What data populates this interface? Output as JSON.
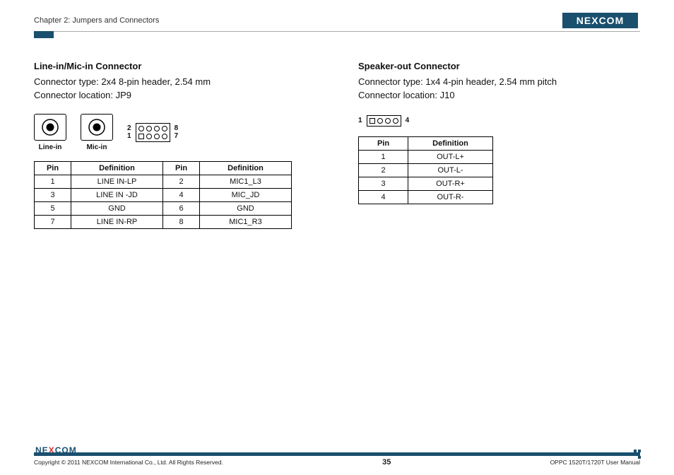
{
  "header": {
    "chapter": "Chapter 2: Jumpers and Connectors",
    "brand": "NEXCOM"
  },
  "left": {
    "title": "Line-in/Mic-in Connector",
    "type_line": "Connector type: 2x4 8-pin header, 2.54 mm",
    "loc_line": "Connector location: JP9",
    "jack1": "Line-in",
    "jack2": "Mic-in",
    "ph_tl": "2",
    "ph_bl": "1",
    "ph_tr": "8",
    "ph_br": "7",
    "cols": {
      "pin": "Pin",
      "def": "Definition"
    },
    "rows": [
      {
        "p1": "1",
        "d1": "LINE IN-LP",
        "p2": "2",
        "d2": "MIC1_L3"
      },
      {
        "p1": "3",
        "d1": "LINE IN -JD",
        "p2": "4",
        "d2": "MIC_JD"
      },
      {
        "p1": "5",
        "d1": "GND",
        "p2": "6",
        "d2": "GND"
      },
      {
        "p1": "7",
        "d1": "LINE IN-RP",
        "p2": "8",
        "d2": "MIC1_R3"
      }
    ]
  },
  "right": {
    "title": "Speaker-out Connector",
    "type_line": "Connector type: 1x4 4-pin header, 2.54 mm pitch",
    "loc_line": "Connector location: J10",
    "ph_left": "1",
    "ph_right": "4",
    "cols": {
      "pin": "Pin",
      "def": "Definition"
    },
    "rows": [
      {
        "p": "1",
        "d": "OUT-L+"
      },
      {
        "p": "2",
        "d": "OUT-L-"
      },
      {
        "p": "3",
        "d": "OUT-R+"
      },
      {
        "p": "4",
        "d": "OUT-R-"
      }
    ]
  },
  "footer": {
    "copyright": "Copyright © 2011 NEXCOM International Co., Ltd. All Rights Reserved.",
    "page": "35",
    "manual": "OPPC 1520T/1720T User Manual"
  }
}
